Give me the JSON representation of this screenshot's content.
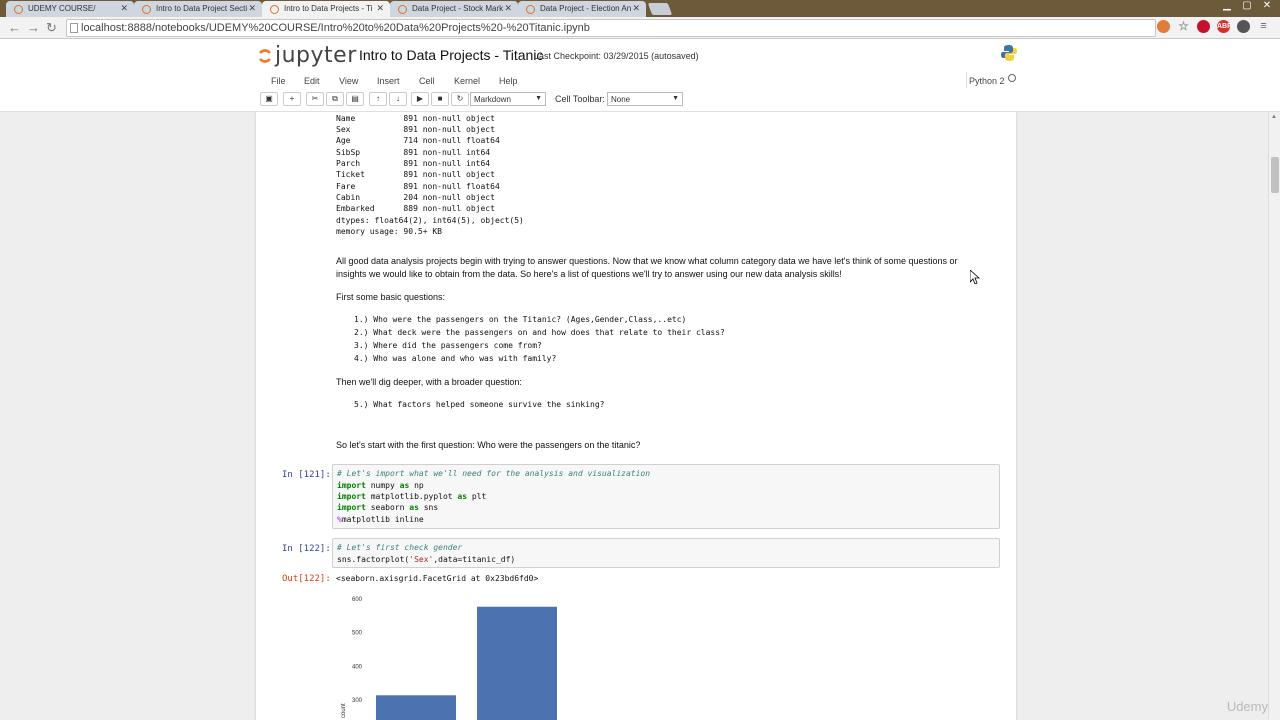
{
  "browser": {
    "tabs": [
      {
        "label": "UDEMY COURSE/",
        "active": false
      },
      {
        "label": "Intro to Data Project Secti",
        "active": false
      },
      {
        "label": "Intro to Data Projects - Ti",
        "active": true
      },
      {
        "label": "Data Project - Stock Mark",
        "active": false
      },
      {
        "label": "Data Project - Election An",
        "active": false
      }
    ],
    "url": "localhost:8888/notebooks/UDEMY%20COURSE/Intro%20to%20Data%20Projects%20-%20Titanic.ipynb"
  },
  "jupyter": {
    "logo_text": "jupyter",
    "title": "Intro to Data Projects - Titanic",
    "checkpoint": "Last Checkpoint: 03/29/2015 (autosaved)",
    "menu": [
      "File",
      "Edit",
      "View",
      "Insert",
      "Cell",
      "Kernel",
      "Help"
    ],
    "kernel": "Python 2",
    "toolbar": {
      "cell_type": "Markdown",
      "cell_toolbar_label": "Cell Toolbar:",
      "cell_toolbar_value": "None"
    }
  },
  "notebook": {
    "info_output": [
      "Name          891 non-null object",
      "Sex           891 non-null object",
      "Age           714 non-null float64",
      "SibSp         891 non-null int64",
      "Parch         891 non-null int64",
      "Ticket        891 non-null object",
      "Fare          891 non-null float64",
      "Cabin         204 non-null object",
      "Embarked      889 non-null object",
      "dtypes: float64(2), int64(5), object(5)",
      "memory usage: 90.5+ KB"
    ],
    "md_intro_1": "All good data analysis projects begin with trying to answer questions. Now that we know what column category data we have let's think of some questions or",
    "md_intro_2": "insights we would like to obtain from the data. So here's a list of questions we'll try to answer using our new data analysis skills!",
    "md_basic": "First some basic questions:",
    "questions": [
      "1.) Who were the passengers on the Titanic? (Ages,Gender,Class,..etc)",
      "2.) What deck were the passengers on and how does that relate to their class?",
      "3.) Where did the passengers come from?",
      "4.) Who was alone and who was with family?"
    ],
    "md_deeper": "Then we'll dig deeper, with a broader question:",
    "question_5": "5.) What factors helped someone survive the sinking?",
    "md_start": "So let's start with the first question: Who were the passengers on the titanic?",
    "cell_121": {
      "prompt": "In [121]:",
      "comment": "# Let's import what we'll need for the analysis and visualization"
    },
    "cell_122": {
      "prompt": "In [122]:",
      "comment": "# Let's first check gender",
      "out_prompt": "Out[122]:",
      "output": "<seaborn.axisgrid.FacetGrid at 0x23bd6fd0>"
    }
  },
  "chart_data": {
    "type": "bar",
    "ylabel": "count",
    "yticks": [
      "300",
      "400",
      "500",
      "600"
    ],
    "values": [
      314,
      577
    ],
    "ylim": [
      0,
      620
    ],
    "colors": [
      "#4c72b0"
    ]
  },
  "udemy": "Udemy"
}
